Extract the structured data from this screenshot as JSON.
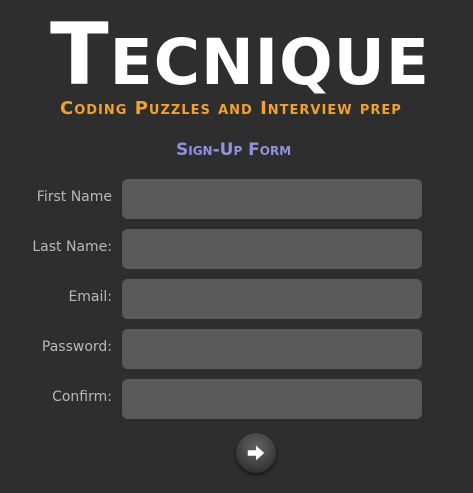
{
  "header": {
    "logo_first": "T",
    "logo_rest": "ECNIQUE",
    "tagline": "Coding Puzzles and Interview prep"
  },
  "form": {
    "title": "Sign-Up Form",
    "fields": [
      {
        "label": "First Name",
        "value": "",
        "placeholder": ""
      },
      {
        "label": "Last Name:",
        "value": "",
        "placeholder": ""
      },
      {
        "label": "Email:",
        "value": "",
        "placeholder": ""
      },
      {
        "label": "Password:",
        "value": "",
        "placeholder": ""
      },
      {
        "label": "Confirm:",
        "value": "",
        "placeholder": ""
      }
    ],
    "submit_icon": "right-arrow-icon"
  },
  "colors": {
    "background": "#2e2e2e",
    "logo": "#ffffff",
    "tagline": "#f2a12b",
    "form_title": "#8f93df",
    "label": "#b8b8b8",
    "field": "#5a5a5a"
  }
}
